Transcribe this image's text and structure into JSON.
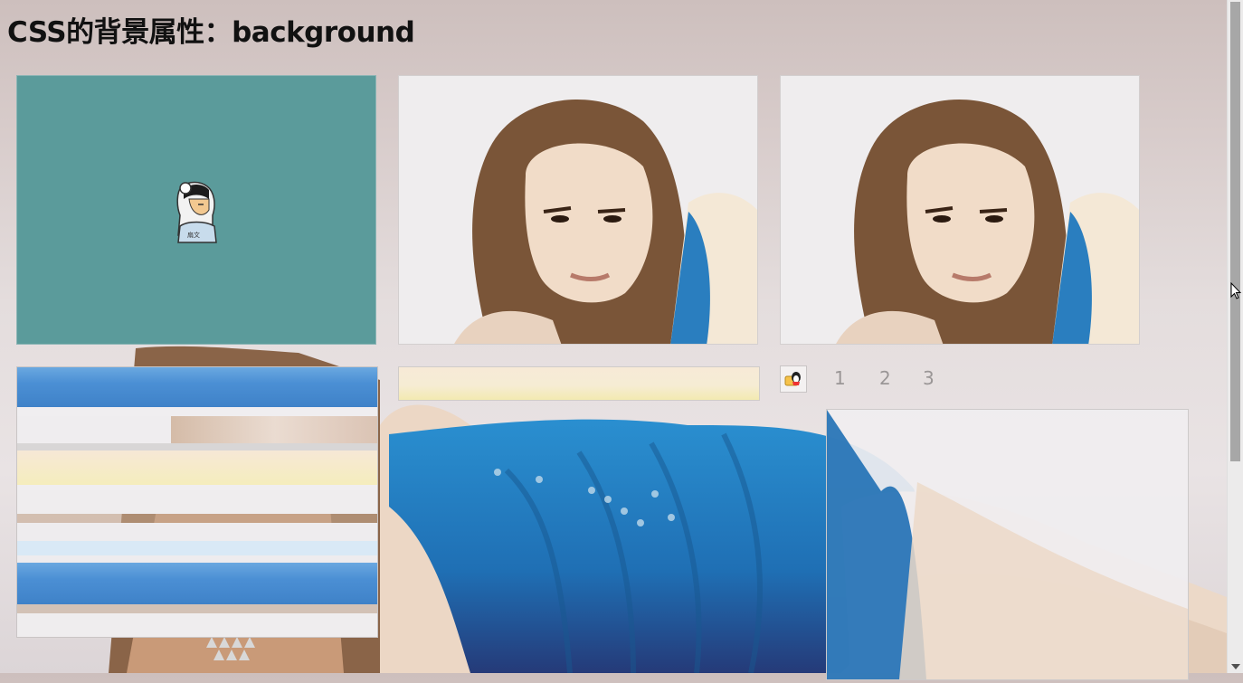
{
  "page": {
    "title": "CSS的背景属性：background"
  },
  "pagination": {
    "pages": [
      "1",
      "2",
      "3"
    ]
  },
  "icons": {
    "cartoon": "cartoon-character-icon",
    "qq": "qq-penguin-icon",
    "cursor": "mouse-pointer-icon"
  },
  "colors": {
    "teal_box": "#5b9b9b",
    "dress_blue": "#1e82c4",
    "bar_blue": "#4a8fd2",
    "bar_yellow": "#f7ecc0"
  }
}
